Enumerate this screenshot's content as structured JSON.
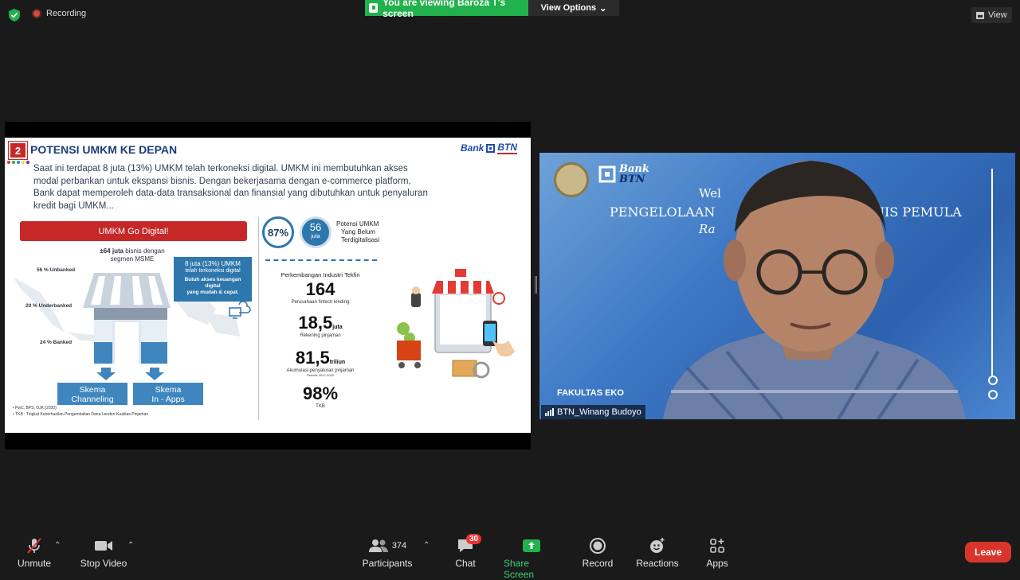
{
  "topbar": {
    "recording_label": "Recording",
    "viewing_label": "You are viewing Baroza T's screen",
    "view_options_label": "View Options",
    "view_label": "View"
  },
  "slide": {
    "number": "2",
    "title": "POTENSI UMKM KE DEPAN",
    "brand_a": "Bank",
    "brand_b": "BTN",
    "paragraph": "Saat ini terdapat 8 juta (13%) UMKM telah terkoneksi digital. UMKM ini membutuhkan akses modal perbankan untuk ekspansi bisnis. Dengan bekerjasama dengan e-commerce platform, Bank dapat memperoleh data-data transaksional dan finansial yang dibutuhkan untuk penyaluran kredit bagi UMKM...",
    "go_digital": "UMKM Go Digital!",
    "msme_bold": "±64 juta",
    "msme_rest": " bisnis dengan",
    "msme_line2": "segmen MSME",
    "unbanked": "56 % Unbanked",
    "underbanked": "20 % Underbanked",
    "banked": "24 % Banked",
    "callout_l1": "8 juta (13%) UMKM",
    "callout_l2": "telah terkoneksi digital",
    "callout_l3": "Butuh akses keuangan digital",
    "callout_l4": "yang mudah & cepat.",
    "skema1_l1": "Skema",
    "skema1_l2": "Channeling",
    "skema2_l1": "Skema",
    "skema2_l2": "In - Apps",
    "footnote1": "PwC, BPS, OJK (2020)",
    "footnote2": "TKB : Tingkat Keberhasilan Pengembalian Dana Lender/ Kualitas Pinjaman",
    "pct87": "87%",
    "pct56": "56",
    "pct56_unit": "juta",
    "potensi_l1": "Potensi UMKM",
    "potensi_l2": "Yang Belum",
    "potensi_l3": "Terdigitalisasi",
    "tekfin_title": "Perkembangan Industri Tekfin",
    "stat1": "164",
    "stat1_sub": "Perusahaan fintech lending",
    "stat2": "18,5",
    "stat2_unit": "juta",
    "stat2_sub": "Rekening pinjaman",
    "stat3": "81,5",
    "stat3_unit": "triliun",
    "stat3_sub": "Akumulasi penyaluran pinjaman",
    "stat3_sub2": "Periode 2017-2020",
    "stat4": "98%",
    "stat4_sub": "TKB"
  },
  "video": {
    "participant_name": "BTN_Winang Budoyo",
    "bg_logo_a": "Bank",
    "bg_logo_b": "BTN",
    "bg_line1": "Wel",
    "bg_line1b": "n",
    "bg_line2a": "PENGELOLAAN",
    "bg_line2b": "SNIS PEMULA",
    "bg_line3": "Ra",
    "bg_line4": "FAKULTAS EKO"
  },
  "toolbar": {
    "unmute": "Unmute",
    "stop_video": "Stop Video",
    "participants": "Participants",
    "participants_count": "374",
    "chat": "Chat",
    "chat_badge": "30",
    "share_screen": "Share Screen",
    "record": "Record",
    "reactions": "Reactions",
    "apps": "Apps",
    "leave": "Leave"
  },
  "colors": {
    "accent_green": "#22b14c",
    "leave_red": "#d9352c",
    "slide_red": "#c62828",
    "slide_blue": "#2e77ad"
  }
}
